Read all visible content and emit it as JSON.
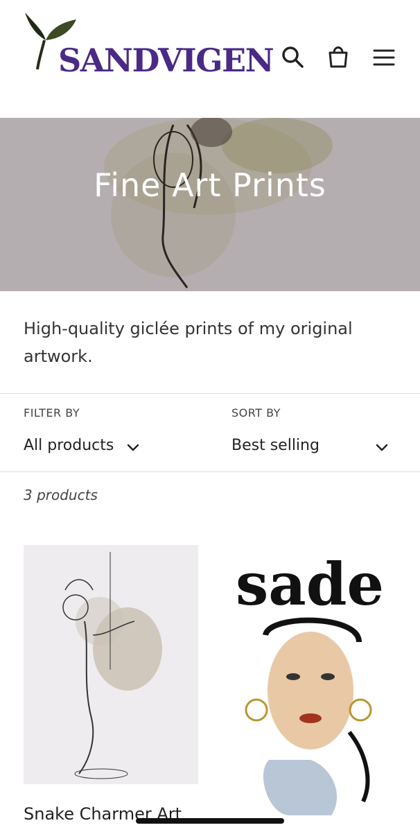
{
  "brand": {
    "name": "SANDVIGEN",
    "color": "#4a2a86"
  },
  "header": {
    "icons": [
      "search-icon",
      "cart-icon",
      "menu-icon"
    ]
  },
  "hero": {
    "title": "Fine Art Prints"
  },
  "collection": {
    "description": "High-quality giclée prints of my original artwork."
  },
  "filter": {
    "label": "FILTER BY",
    "value": "All products"
  },
  "sort": {
    "label": "SORT BY",
    "value": "Best selling"
  },
  "results": {
    "count_text": "3 products"
  },
  "products": [
    {
      "title": "Snake Charmer Art"
    },
    {
      "title": ""
    }
  ],
  "art": {
    "sade_text": "sade"
  }
}
